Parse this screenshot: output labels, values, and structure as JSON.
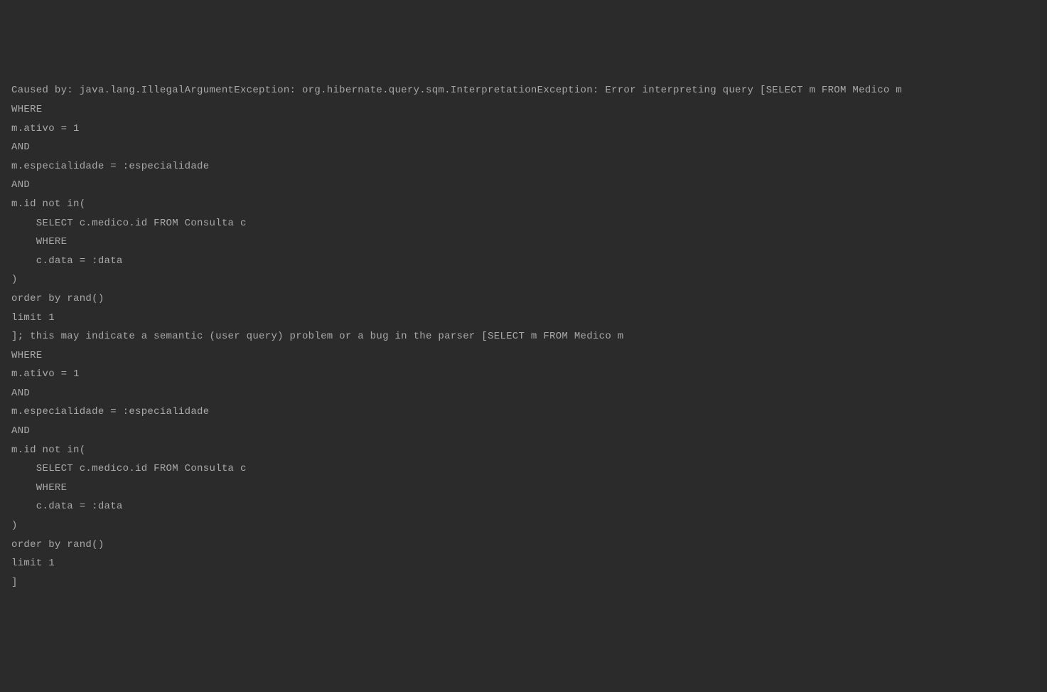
{
  "error_output": {
    "lines": [
      "Caused by: java.lang.IllegalArgumentException: org.hibernate.query.sqm.InterpretationException: Error interpreting query [SELECT m FROM Medico m",
      "WHERE",
      "m.ativo = 1",
      "AND",
      "m.especialidade = :especialidade",
      "AND",
      "m.id not in(",
      "    SELECT c.medico.id FROM Consulta c",
      "    WHERE",
      "    c.data = :data",
      ")",
      "order by rand()",
      "limit 1",
      "]; this may indicate a semantic (user query) problem or a bug in the parser [SELECT m FROM Medico m",
      "WHERE",
      "m.ativo = 1",
      "AND",
      "m.especialidade = :especialidade",
      "AND",
      "m.id not in(",
      "    SELECT c.medico.id FROM Consulta c",
      "    WHERE",
      "    c.data = :data",
      ")",
      "order by rand()",
      "limit 1",
      "]"
    ]
  }
}
